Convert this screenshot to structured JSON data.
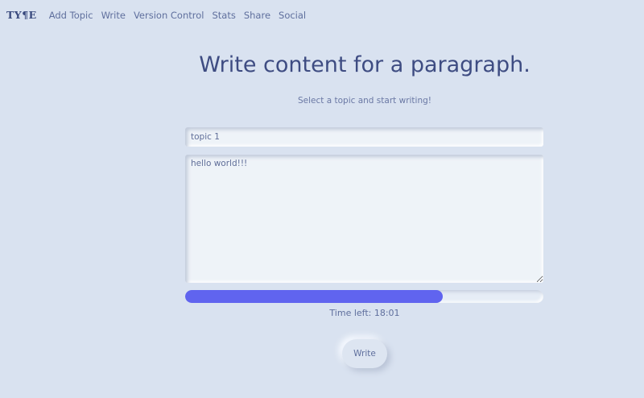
{
  "nav": {
    "logo": "TY¶E",
    "links": [
      "Add Topic",
      "Write",
      "Version Control",
      "Stats",
      "Share",
      "Social"
    ]
  },
  "main": {
    "title": "Write content for a paragraph.",
    "subtitle": "Select a topic and start writing!",
    "topic_value": "topic 1",
    "content_value": "hello world!!!",
    "progress_fraction": 0.72,
    "time_left": "Time left: 18:01",
    "write_label": "Write"
  },
  "colors": {
    "background": "#d9e2f0",
    "accent": "#6064ef",
    "text": "#3e4c82"
  }
}
